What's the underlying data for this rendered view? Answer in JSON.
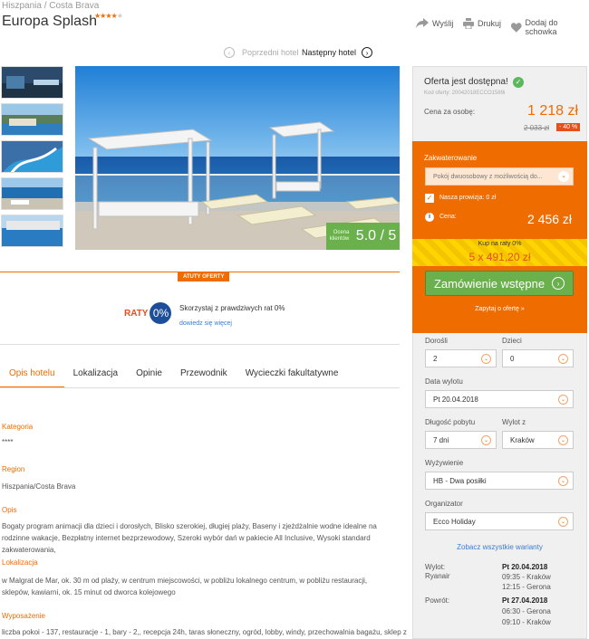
{
  "breadcrumb": "Hiszpania /  Costa Brava",
  "hotel": {
    "name": "Europa Splash",
    "stars": 4,
    "stars_shown": "★★★★",
    "star_empty": "★"
  },
  "actions": {
    "share": "Wyślij",
    "print": "Drukuj",
    "save": "Dodaj do schowka"
  },
  "hotel_nav": {
    "prev": "Poprzedni hotel",
    "next": "Następny hotel"
  },
  "rating": {
    "label": "Ocena\nklientów",
    "label1": "Ocena",
    "label2": "klientów",
    "value": "5.0 / 5"
  },
  "atuty": {
    "header": "ATUTY OFERTY",
    "raty_logo": "RATY",
    "raty_zero": "0%",
    "raty_text": "Skorzystaj z prawdziwych rat 0%",
    "raty_link": "dowiedz się więcej"
  },
  "tabs": [
    "Opis hotelu",
    "Lokalizacja",
    "Opinie",
    "Przewodnik",
    "Wycieczki fakultatywne"
  ],
  "description": {
    "kategoria_h": "Kategoria",
    "kategoria": "****",
    "region_h": "Region",
    "region": "Hiszpania/Costa Brava",
    "opis_h": "Opis",
    "opis": "Bogaty program animacji dla dzieci i dorosłych, Blisko szerokiej, długiej plaży, Baseny i zjeżdżalnie wodne idealne na rodzinne wakacje, Bezpłatny internet bezprzewodowy, Szeroki wybór dań w pakiecie All Inclusive, Wysoki standard zakwaterowania,",
    "lok_h": "Lokalizacja",
    "lok": "w Malgrat de Mar, ok. 30 m od plaży, w centrum miejscowości, w pobliżu lokalnego centrum, w pobliżu restauracji, sklepów, kawiarni, ok. 15 minut od dworca kolejowego",
    "wyp_h": "Wyposażenie",
    "wyp": "liczba pokoi - 137, restauracje - 1, bary - 2,, recepcja 24h, taras słoneczny, ogród, lobby, windy, przechowalnia bagażu, sklep z"
  },
  "offer": {
    "status": "Oferta jest dostępna!",
    "code": "Kod oferty: 20042018ECCO1589i",
    "per_person_label": "Cena za osobę:",
    "per_person": "1 218 zł",
    "old_price": "2 033 zł",
    "discount": "- 40 %",
    "accommodation_label": "Zakwaterowanie",
    "room": "Pokój dwuosobowy z możliwością do...",
    "commission": "Nasza prowizja: 0 zł",
    "price_label": "Cena:",
    "price": "2 456 zł",
    "raty_label": "Kup na raty 0%",
    "raty_value": "5 x 491,20 zł",
    "order_button": "Zamówienie wstępne",
    "ask_link": "Zapytaj o ofertę »"
  },
  "form": {
    "adults_label": "Dorośli",
    "adults": "2",
    "children_label": "Dzieci",
    "children": "0",
    "date_label": "Data wylotu",
    "date": "Pt 20.04.2018",
    "length_label": "Długość pobytu",
    "length": "7 dni",
    "departure_label": "Wylot z",
    "departure": "Kraków",
    "board_label": "Wyżywienie",
    "board": "HB - Dwa posiłki",
    "organizer_label": "Organizator",
    "organizer": "Ecco Holiday",
    "variants_link": "Zobacz wszystkie warianty"
  },
  "flights": {
    "out_label": "Wylot:",
    "airline": "Ryanair",
    "out_date": "Pt 20.04.2018",
    "out_1": "09:35 - Kraków",
    "out_2": "12:15 - Gerona",
    "ret_label": "Powrót:",
    "ret_date": "Pt 27.04.2018",
    "ret_1": "06:30 - Gerona",
    "ret_2": "09:10 - Kraków"
  },
  "colors": {
    "accent": "#ef6c00",
    "green": "#6ab04c",
    "blue": "#1d4e9a"
  }
}
